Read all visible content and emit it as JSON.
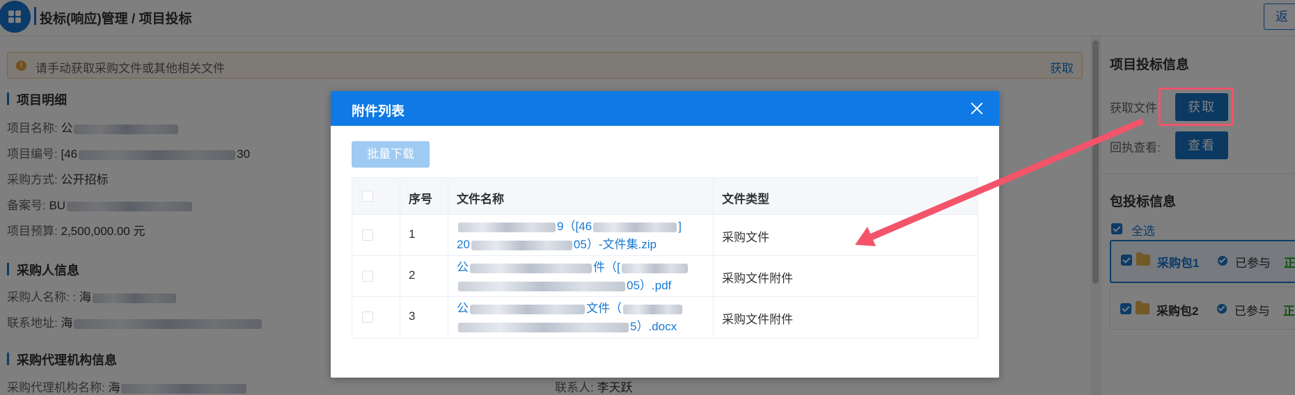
{
  "header": {
    "title": "投标(响应)管理 / 项目投标",
    "back_label": "返"
  },
  "alert": {
    "text": "请手动获取采购文件或其他相关文件",
    "link": "获取"
  },
  "project": {
    "section_title": "项目明细",
    "name_label": "项目名称:",
    "name_value": "公",
    "code_label": "项目编号:",
    "code_prefix": "[46",
    "code_suffix": "30",
    "method_label": "采购方式:",
    "method_value": "公开招标",
    "record_label": "备案号:",
    "record_value": "BU",
    "budget_label": "项目预算:",
    "budget_value": "2,500,000.00 元"
  },
  "purchaser": {
    "section_title": "采购人信息",
    "name_label": "采购人名称: :",
    "name_value": "海",
    "address_label": "联系地址:",
    "address_value": "海"
  },
  "agency": {
    "section_title": "采购代理机构信息",
    "name_label": "采购代理机构名称:",
    "name_value": "海",
    "contact_label": "联系人:",
    "contact_value": "李天跃"
  },
  "right_panel": {
    "bid_info_title": "项目投标信息",
    "get_file_label": "获取文件",
    "get_button": "获取",
    "receipt_label": "回执查看:",
    "view_button": "查看",
    "package_title": "包投标信息",
    "select_all": "全选",
    "packages": [
      {
        "name": "采购包1",
        "status": "已参与",
        "tail": "正"
      },
      {
        "name": "采购包2",
        "status": "已参与",
        "tail": "正"
      }
    ]
  },
  "dialog": {
    "title": "附件列表",
    "batch_download": "批量下载",
    "columns": [
      "序号",
      "文件名称",
      "文件类型"
    ],
    "rows": [
      {
        "index": "1",
        "name_line1": "9（[46",
        "name_line1_end": "]",
        "name_line2_start": "20",
        "name_line2_end": "05）-文件集.zip",
        "type": "采购文件"
      },
      {
        "index": "2",
        "name_line1": "公",
        "name_line1_end": "件（[",
        "name_line2_start": "",
        "name_line2_end": "05）.pdf",
        "type": "采购文件附件"
      },
      {
        "index": "3",
        "name_line1": "公",
        "name_line1_end": "文件（",
        "name_line2_start": "",
        "name_line2_end": "5）.docx",
        "type": "采购文件附件"
      }
    ]
  },
  "colors": {
    "primary": "#1677d2",
    "dialog_header": "#0f7ae5",
    "annotation": "#f3546a",
    "success": "#2ba02b"
  }
}
